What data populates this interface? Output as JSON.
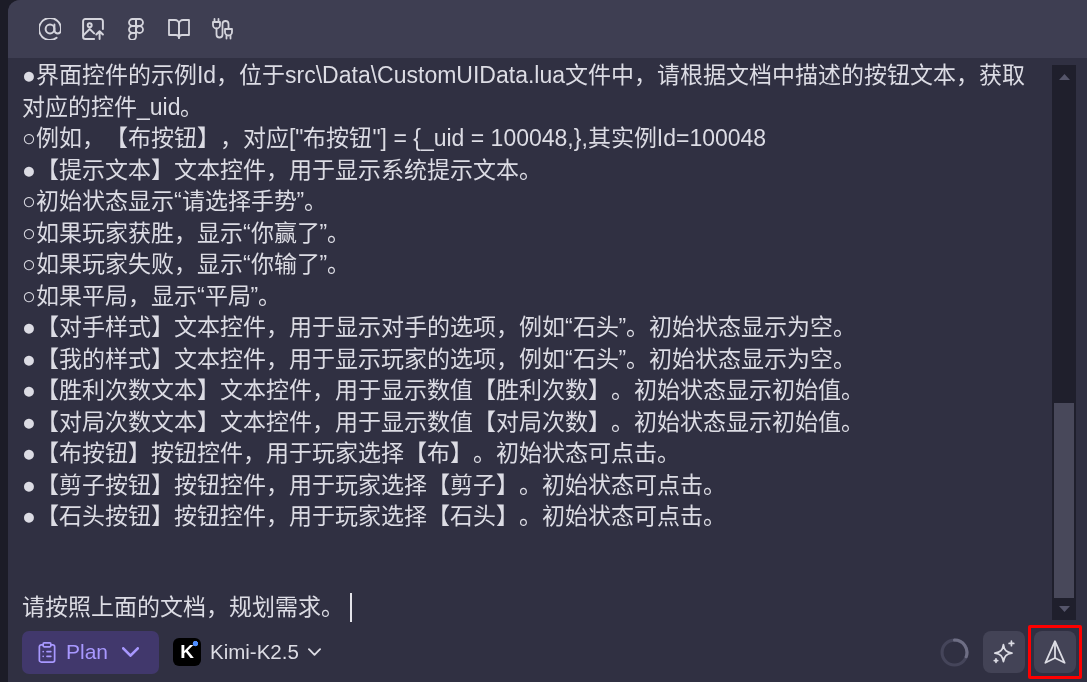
{
  "input": {
    "focused": true,
    "paragraphs": [
      "●界面控件的示例Id，位于src\\Data\\CustomUIData.lua文件中，请根据文档中描述的按钮文本，获取对应的控件_uid。",
      "○例如，【布按钮】，对应[\"布按钮\"] = {_uid = 100048,},其实例Id=100048",
      "●【提示文本】文本控件，用于显示系统提示文本。",
      "○初始状态显示“请选择手势”。",
      "○如果玩家获胜，显示“你赢了”。",
      "○如果玩家失败，显示“你输了”。",
      "○如果平局，显示“平局”。",
      "●【对手样式】文本控件，用于显示对手的选项，例如“石头”。初始状态显示为空。",
      "●【我的样式】文本控件，用于显示玩家的选项，例如“石头”。初始状态显示为空。",
      "●【胜利次数文本】文本控件，用于显示数值【胜利次数】。初始状态显示初始值。",
      "●【对局次数文本】文本控件，用于显示数值【对局次数】。初始状态显示初始值。",
      "●【布按钮】按钮控件，用于玩家选择【布】。初始状态可点击。",
      "●【剪子按钮】按钮控件，用于玩家选择【剪子】。初始状态可点击。",
      "●【石头按钮】按钮控件，用于玩家选择【石头】。初始状态可点击。"
    ],
    "last_line": "请按照上面的文档，规划需求。"
  },
  "mode_button": {
    "label": "Plan"
  },
  "model_selector": {
    "logo": "K",
    "label": "Kimi-K2.5"
  },
  "loading": true,
  "send_button": {
    "highlighted": true
  }
}
